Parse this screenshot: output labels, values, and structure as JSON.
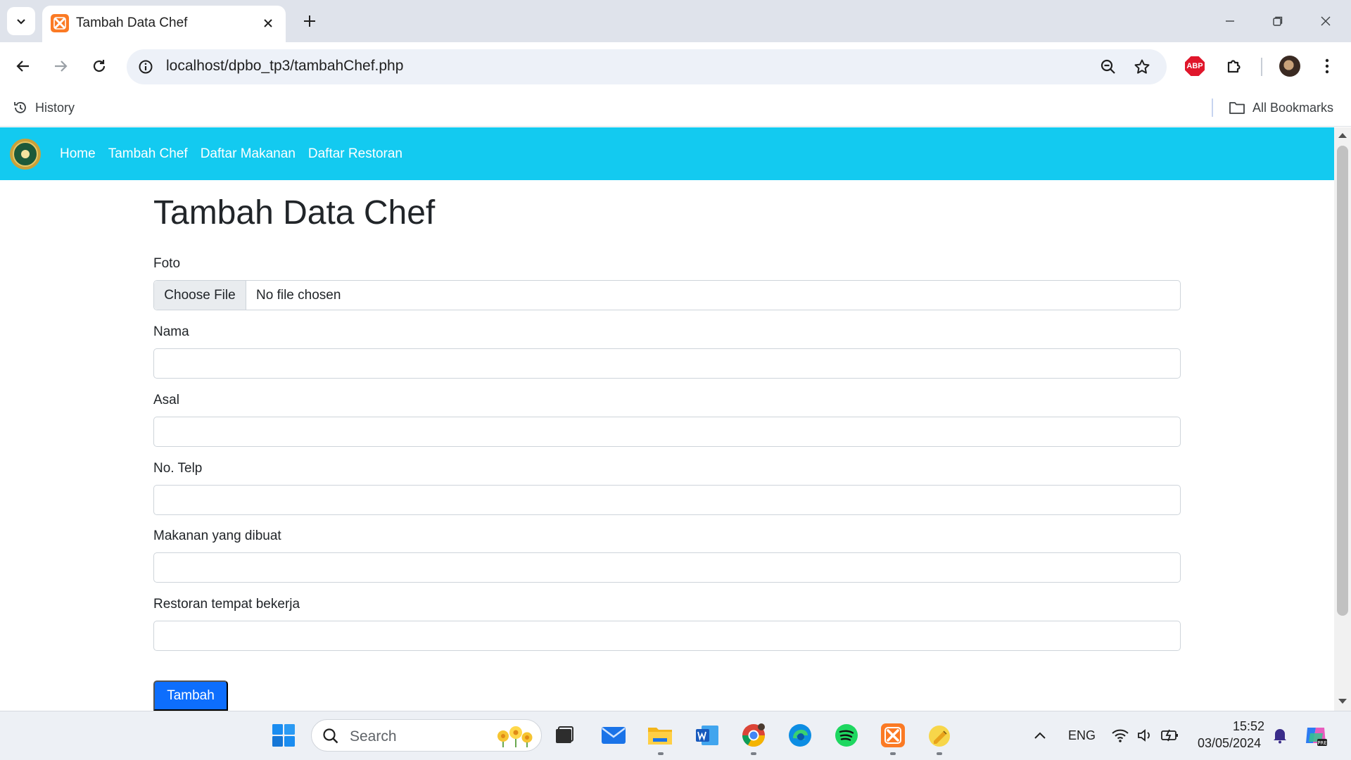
{
  "browser": {
    "tab_title": "Tambah Data Chef",
    "url": "localhost/dpbo_tp3/tambahChef.php",
    "bookmarks": {
      "history_label": "History",
      "all_bookmarks_label": "All Bookmarks"
    },
    "abp_label": "ABP"
  },
  "navbar": {
    "links": [
      {
        "label": "Home"
      },
      {
        "label": "Tambah Chef"
      },
      {
        "label": "Daftar Makanan"
      },
      {
        "label": "Daftar Restoran"
      }
    ],
    "background_color": "#13caf0"
  },
  "form": {
    "title": "Tambah Data Chef",
    "foto": {
      "label": "Foto",
      "button_label": "Choose File",
      "status": "No file chosen"
    },
    "fields": [
      {
        "label": "Nama",
        "value": ""
      },
      {
        "label": "Asal",
        "value": ""
      },
      {
        "label": "No. Telp",
        "value": ""
      },
      {
        "label": "Makanan yang dibuat",
        "value": ""
      },
      {
        "label": "Restoran tempat bekerja",
        "value": ""
      }
    ],
    "submit_label": "Tambah",
    "submit_color": "#0d6efd"
  },
  "taskbar": {
    "search_placeholder": "Search",
    "language": "ENG",
    "time": "15:52",
    "date": "03/05/2024"
  }
}
